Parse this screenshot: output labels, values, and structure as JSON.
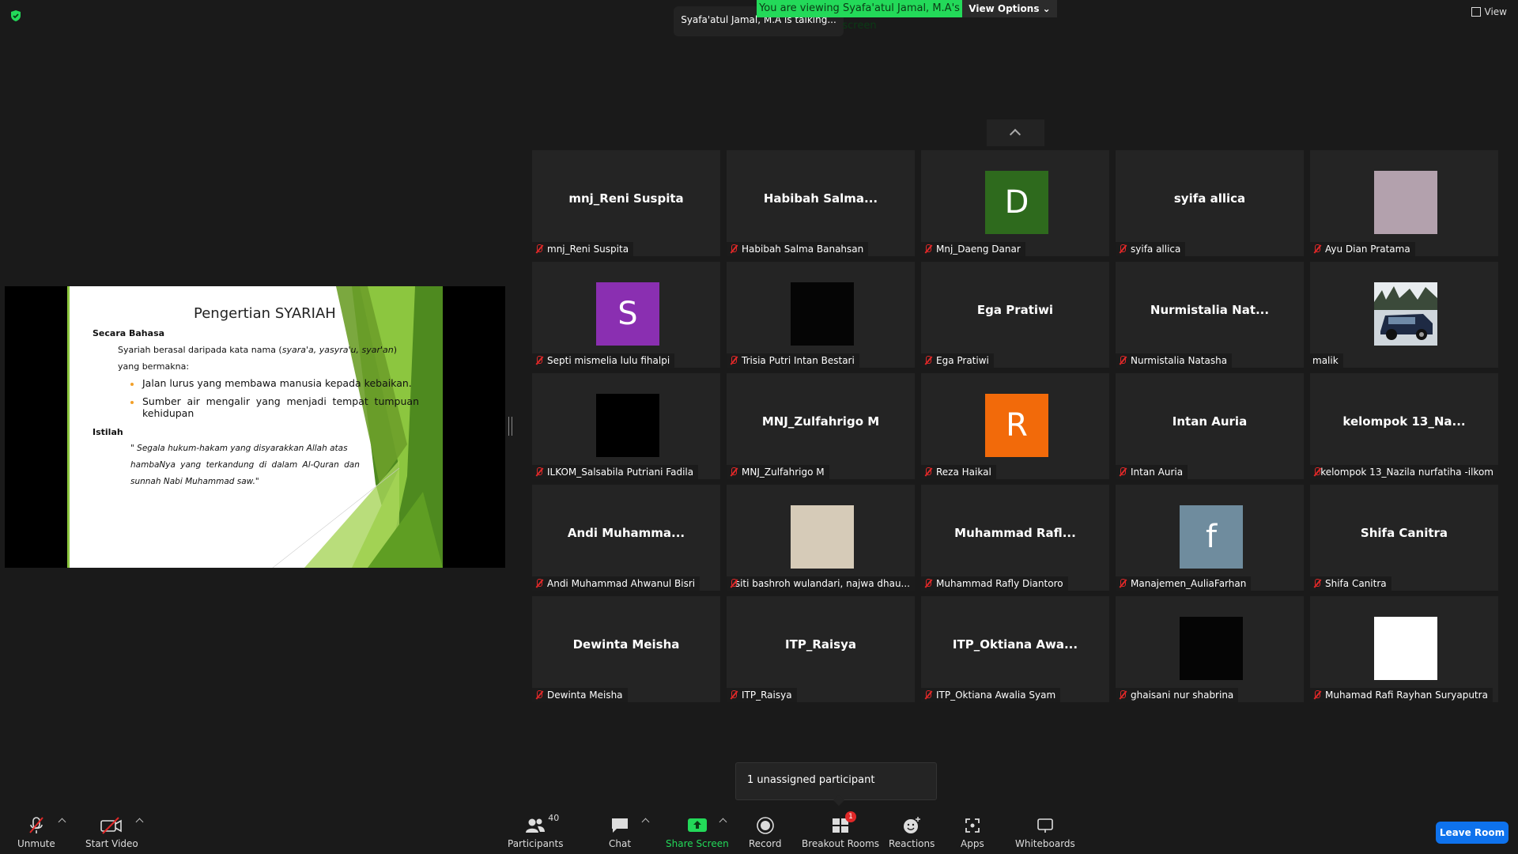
{
  "banner": {
    "viewing": "You are viewing Syafa'atul Jamal, M.A's screen",
    "view_options": "View Options",
    "talking": "Syafa'atul Jamal, M.A is talking...",
    "view": "View"
  },
  "slide": {
    "title": "Pengertian SYARIAH",
    "heading1": "Secara Bahasa",
    "line1a": "Syariah berasal daripada kata nama (",
    "line1b": "syara'a, yasyra'u, syar'an",
    "line1c": ")",
    "line2": "yang bermakna:",
    "bullet1": "Jalan lurus yang membawa manusia kepada kebaikan.",
    "bullet2a": "Sumber air mengalir yang menjadi tempat tumpuan",
    "bullet2b": "kehidupan",
    "heading2": "Istilah",
    "quote1": "\" Segala hukum-hakam yang disyarakkan Allah atas",
    "quote2": "hambaNya yang terkandung di dalam Al-Quran dan",
    "quote3": "sunnah Nabi Muhammad saw.\""
  },
  "tiles": [
    {
      "big": "mnj_Reni Suspita",
      "name": "mnj_Reni Suspita",
      "muted": true
    },
    {
      "big": "Habibah Salma...",
      "name": "Habibah Salma Banahsan",
      "muted": true
    },
    {
      "letter": "D",
      "color": "#2e6a1d",
      "name": "Mnj_Daeng Danar",
      "muted": true
    },
    {
      "big": "syifa allica",
      "name": "syifa allica",
      "muted": true
    },
    {
      "color": "#b3a1ad",
      "name": "Ayu Dian Pratama",
      "muted": true
    },
    {
      "letter": "S",
      "color": "#8a2fb1",
      "name": "Septi mismelia lulu fihalpi",
      "muted": true
    },
    {
      "color": "#050505",
      "name": "Trisia Putri Intan Bestari",
      "muted": true
    },
    {
      "big": "Ega Pratiwi",
      "name": "Ega Pratiwi",
      "muted": true
    },
    {
      "big": "Nurmistalia Nat...",
      "name": "Nurmistalia Natasha",
      "muted": true
    },
    {
      "photo": true,
      "name": "malik",
      "muted": false
    },
    {
      "color": "#000000",
      "name": "ILKOM_Salsabila Putriani Fadila",
      "muted": true
    },
    {
      "big": "MNJ_Zulfahrigo M",
      "name": "MNJ_Zulfahrigo M",
      "muted": true
    },
    {
      "letter": "R",
      "color": "#f26a0a",
      "name": "Reza Haikal",
      "muted": true
    },
    {
      "big": "Intan Auria",
      "name": "Intan Auria",
      "muted": true
    },
    {
      "big": "kelompok 13_Na...",
      "name": "kelompok 13_Nazila nurfatiha -ilkom",
      "muted": true
    },
    {
      "big": "Andi Muhamma...",
      "name": "Andi Muhammad Ahwanul Bisri",
      "muted": true
    },
    {
      "color": "#d6cbb8",
      "name": "siti bashroh wulandari, najwa dhau...",
      "muted": true
    },
    {
      "big": "Muhammad Rafl...",
      "name": "Muhammad Rafly Diantoro",
      "muted": true
    },
    {
      "letter": "f",
      "color": "#6f8c9e",
      "name": "Manajemen_AuliaFarhan",
      "muted": true
    },
    {
      "big": "Shifa Canitra",
      "name": "Shifa Canitra",
      "muted": true
    },
    {
      "big": "Dewinta Meisha",
      "name": "Dewinta Meisha",
      "muted": true
    },
    {
      "big": "ITP_Raisya",
      "name": "ITP_Raisya",
      "muted": true
    },
    {
      "big": "ITP_Oktiana Awa...",
      "name": "ITP_Oktiana Awalia Syam",
      "muted": true
    },
    {
      "color": "#050505",
      "name": "ghaisani nur shabrina",
      "muted": true
    },
    {
      "color": "#ffffff",
      "name": "Muhamad Rafi Rayhan Suryaputra",
      "muted": true
    }
  ],
  "tooltip": "1 unassigned participant",
  "toolbar": {
    "unmute": "Unmute",
    "start_video": "Start Video",
    "participants": "Participants",
    "participant_count": "40",
    "chat": "Chat",
    "share_screen": "Share Screen",
    "record": "Record",
    "breakout": "Breakout Rooms",
    "breakout_badge": "1",
    "reactions": "Reactions",
    "apps": "Apps",
    "whiteboards": "Whiteboards",
    "leave": "Leave Room"
  },
  "colors": {
    "share_green": "#23d959",
    "leave_blue": "#0e72ed",
    "muted_red": "#e02828"
  }
}
